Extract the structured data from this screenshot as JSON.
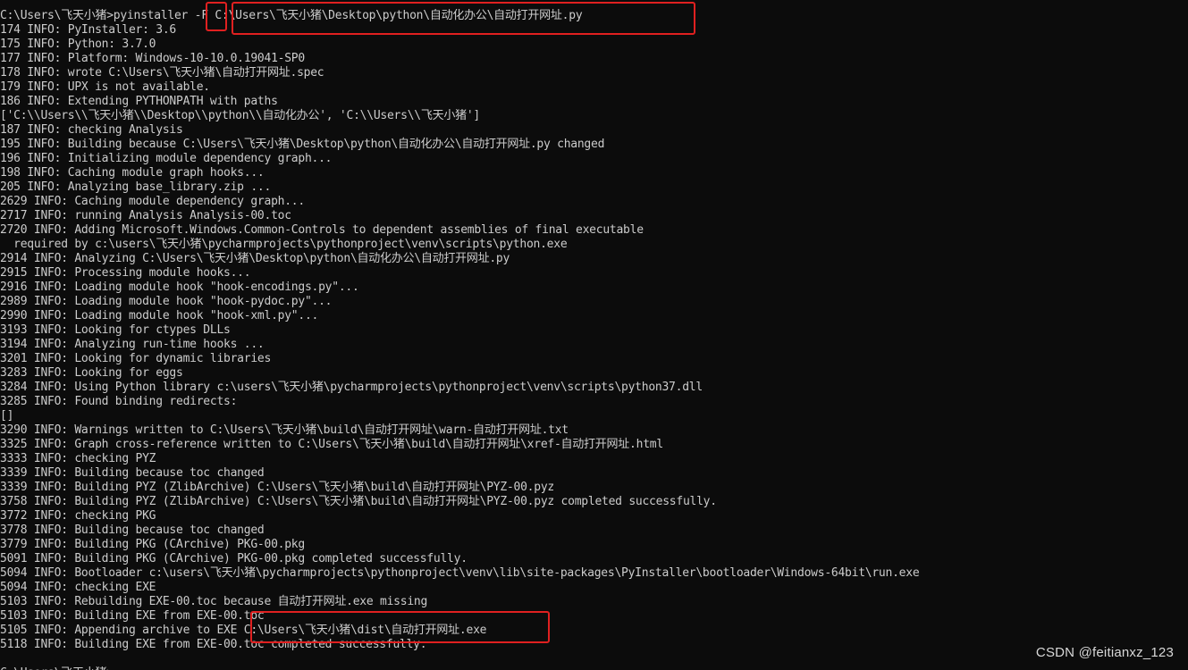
{
  "terminal": {
    "lines": [
      "C:\\Users\\飞天小猪>pyinstaller -F C:\\Users\\飞天小猪\\Desktop\\python\\自动化办公\\自动打开网址.py",
      "174 INFO: PyInstaller: 3.6",
      "175 INFO: Python: 3.7.0",
      "177 INFO: Platform: Windows-10-10.0.19041-SP0",
      "178 INFO: wrote C:\\Users\\飞天小猪\\自动打开网址.spec",
      "179 INFO: UPX is not available.",
      "186 INFO: Extending PYTHONPATH with paths",
      "['C:\\\\Users\\\\飞天小猪\\\\Desktop\\\\python\\\\自动化办公', 'C:\\\\Users\\\\飞天小猪']",
      "187 INFO: checking Analysis",
      "195 INFO: Building because C:\\Users\\飞天小猪\\Desktop\\python\\自动化办公\\自动打开网址.py changed",
      "196 INFO: Initializing module dependency graph...",
      "198 INFO: Caching module graph hooks...",
      "205 INFO: Analyzing base_library.zip ...",
      "2629 INFO: Caching module dependency graph...",
      "2717 INFO: running Analysis Analysis-00.toc",
      "2720 INFO: Adding Microsoft.Windows.Common-Controls to dependent assemblies of final executable",
      "  required by c:\\users\\飞天小猪\\pycharmprojects\\pythonproject\\venv\\scripts\\python.exe",
      "2914 INFO: Analyzing C:\\Users\\飞天小猪\\Desktop\\python\\自动化办公\\自动打开网址.py",
      "2915 INFO: Processing module hooks...",
      "2916 INFO: Loading module hook \"hook-encodings.py\"...",
      "2989 INFO: Loading module hook \"hook-pydoc.py\"...",
      "2990 INFO: Loading module hook \"hook-xml.py\"...",
      "3193 INFO: Looking for ctypes DLLs",
      "3194 INFO: Analyzing run-time hooks ...",
      "3201 INFO: Looking for dynamic libraries",
      "3283 INFO: Looking for eggs",
      "3284 INFO: Using Python library c:\\users\\飞天小猪\\pycharmprojects\\pythonproject\\venv\\scripts\\python37.dll",
      "3285 INFO: Found binding redirects:",
      "[]",
      "3290 INFO: Warnings written to C:\\Users\\飞天小猪\\build\\自动打开网址\\warn-自动打开网址.txt",
      "3325 INFO: Graph cross-reference written to C:\\Users\\飞天小猪\\build\\自动打开网址\\xref-自动打开网址.html",
      "3333 INFO: checking PYZ",
      "3339 INFO: Building because toc changed",
      "3339 INFO: Building PYZ (ZlibArchive) C:\\Users\\飞天小猪\\build\\自动打开网址\\PYZ-00.pyz",
      "3758 INFO: Building PYZ (ZlibArchive) C:\\Users\\飞天小猪\\build\\自动打开网址\\PYZ-00.pyz completed successfully.",
      "3772 INFO: checking PKG",
      "3778 INFO: Building because toc changed",
      "3779 INFO: Building PKG (CArchive) PKG-00.pkg",
      "5091 INFO: Building PKG (CArchive) PKG-00.pkg completed successfully.",
      "5094 INFO: Bootloader c:\\users\\飞天小猪\\pycharmprojects\\pythonproject\\venv\\lib\\site-packages\\PyInstaller\\bootloader\\Windows-64bit\\run.exe",
      "5094 INFO: checking EXE",
      "5103 INFO: Rebuilding EXE-00.toc because 自动打开网址.exe missing",
      "5103 INFO: Building EXE from EXE-00.toc",
      "5105 INFO: Appending archive to EXE C:\\Users\\飞天小猪\\dist\\自动打开网址.exe",
      "5118 INFO: Building EXE from EXE-00.toc completed successfully.",
      "",
      "C:\\Users\\飞天小猪>"
    ]
  },
  "watermark": "CSDN @feitianxz_123",
  "colors": {
    "background": "#0c0c0c",
    "text": "#cccccc",
    "highlight": "#e02020"
  }
}
